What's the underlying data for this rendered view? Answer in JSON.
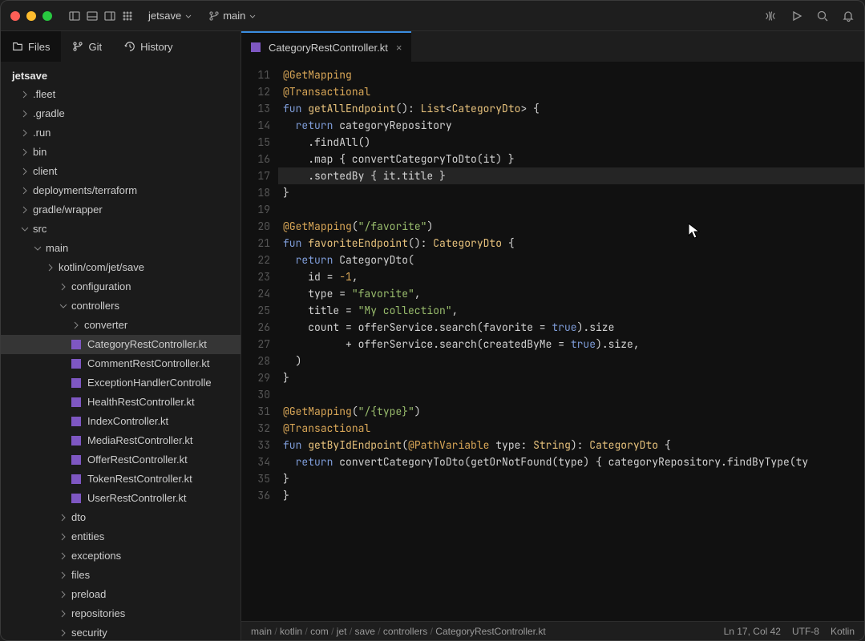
{
  "title_bar": {
    "project": "jetsave",
    "branch": "main"
  },
  "sidebar": {
    "tabs": [
      {
        "label": "Files",
        "active": true
      },
      {
        "label": "Git",
        "active": false
      },
      {
        "label": "History",
        "active": false
      }
    ],
    "root": "jetsave",
    "tree": [
      {
        "d": 1,
        "k": "f",
        "label": ".fleet"
      },
      {
        "d": 1,
        "k": "f",
        "label": ".gradle"
      },
      {
        "d": 1,
        "k": "f",
        "label": ".run"
      },
      {
        "d": 1,
        "k": "f",
        "label": "bin"
      },
      {
        "d": 1,
        "k": "f",
        "label": "client"
      },
      {
        "d": 1,
        "k": "f",
        "label": "deployments/terraform"
      },
      {
        "d": 1,
        "k": "f",
        "label": "gradle/wrapper"
      },
      {
        "d": 1,
        "k": "fo",
        "label": "src"
      },
      {
        "d": 2,
        "k": "fo",
        "label": "main"
      },
      {
        "d": 3,
        "k": "f",
        "label": "kotlin/com/jet/save"
      },
      {
        "d": 4,
        "k": "f",
        "label": "configuration"
      },
      {
        "d": 4,
        "k": "fo",
        "label": "controllers"
      },
      {
        "d": 5,
        "k": "f",
        "label": "converter"
      },
      {
        "d": 5,
        "k": "kt",
        "label": "CategoryRestController.kt",
        "sel": true
      },
      {
        "d": 5,
        "k": "kt",
        "label": "CommentRestController.kt"
      },
      {
        "d": 5,
        "k": "kt",
        "label": "ExceptionHandlerControlle"
      },
      {
        "d": 5,
        "k": "kt",
        "label": "HealthRestController.kt"
      },
      {
        "d": 5,
        "k": "kt",
        "label": "IndexController.kt"
      },
      {
        "d": 5,
        "k": "kt",
        "label": "MediaRestController.kt"
      },
      {
        "d": 5,
        "k": "kt",
        "label": "OfferRestController.kt"
      },
      {
        "d": 5,
        "k": "kt",
        "label": "TokenRestController.kt"
      },
      {
        "d": 5,
        "k": "kt",
        "label": "UserRestController.kt"
      },
      {
        "d": 4,
        "k": "f",
        "label": "dto"
      },
      {
        "d": 4,
        "k": "f",
        "label": "entities"
      },
      {
        "d": 4,
        "k": "f",
        "label": "exceptions"
      },
      {
        "d": 4,
        "k": "f",
        "label": "files"
      },
      {
        "d": 4,
        "k": "f",
        "label": "preload"
      },
      {
        "d": 4,
        "k": "f",
        "label": "repositories"
      },
      {
        "d": 4,
        "k": "f",
        "label": "security"
      }
    ]
  },
  "editor": {
    "tab_label": "CategoryRestController.kt",
    "first_line": 11,
    "highlight_line": 17,
    "lines": [
      [
        [
          "@",
          "ann"
        ],
        [
          "GetMapping",
          "ann"
        ]
      ],
      [
        [
          "@",
          "ann"
        ],
        [
          "Transactional",
          "ann"
        ]
      ],
      [
        [
          "fun ",
          "kw"
        ],
        [
          "getAllEndpoint",
          "fn"
        ],
        [
          "(): ",
          ""
        ],
        [
          "List",
          "type"
        ],
        [
          "<",
          ""
        ],
        [
          "CategoryDto",
          "type"
        ],
        [
          "> {",
          ""
        ]
      ],
      [
        [
          "  ",
          ""
        ],
        [
          "return ",
          "kw"
        ],
        [
          "categoryRepository",
          ""
        ]
      ],
      [
        [
          "    .findAll()",
          ""
        ]
      ],
      [
        [
          "    .map { convertCategoryToDto(it) }",
          ""
        ]
      ],
      [
        [
          "    .sortedBy { it.title }",
          ""
        ]
      ],
      [
        [
          "}",
          ""
        ]
      ],
      [
        [
          "",
          ""
        ]
      ],
      [
        [
          "@",
          "ann"
        ],
        [
          "GetMapping",
          "ann"
        ],
        [
          "(",
          ""
        ],
        [
          "\"/favorite\"",
          "str"
        ],
        [
          ")",
          ""
        ]
      ],
      [
        [
          "fun ",
          "kw"
        ],
        [
          "favoriteEndpoint",
          "fn"
        ],
        [
          "(): ",
          ""
        ],
        [
          "CategoryDto",
          "type"
        ],
        [
          " {",
          ""
        ]
      ],
      [
        [
          "  ",
          ""
        ],
        [
          "return ",
          "kw"
        ],
        [
          "CategoryDto(",
          ""
        ]
      ],
      [
        [
          "    id = ",
          ""
        ],
        [
          "-1",
          "lit"
        ],
        [
          ",",
          ""
        ]
      ],
      [
        [
          "    type = ",
          ""
        ],
        [
          "\"favorite\"",
          "str"
        ],
        [
          ",",
          ""
        ]
      ],
      [
        [
          "    title = ",
          ""
        ],
        [
          "\"My collection\"",
          "str"
        ],
        [
          ",",
          ""
        ]
      ],
      [
        [
          "    count = offerService.search(favorite = ",
          ""
        ],
        [
          "true",
          "kw"
        ],
        [
          ").size",
          ""
        ]
      ],
      [
        [
          "          + offerService.search(createdByMe = ",
          ""
        ],
        [
          "true",
          "kw"
        ],
        [
          ").size,",
          ""
        ]
      ],
      [
        [
          "  )",
          ""
        ]
      ],
      [
        [
          "}",
          ""
        ]
      ],
      [
        [
          "",
          ""
        ]
      ],
      [
        [
          "@",
          "ann"
        ],
        [
          "GetMapping",
          "ann"
        ],
        [
          "(",
          ""
        ],
        [
          "\"/{type}\"",
          "str"
        ],
        [
          ")",
          ""
        ]
      ],
      [
        [
          "@",
          "ann"
        ],
        [
          "Transactional",
          "ann"
        ]
      ],
      [
        [
          "fun ",
          "kw"
        ],
        [
          "getByIdEndpoint",
          "fn"
        ],
        [
          "(",
          ""
        ],
        [
          "@",
          "ann"
        ],
        [
          "PathVariable",
          "ann"
        ],
        [
          " type: ",
          ""
        ],
        [
          "String",
          "type"
        ],
        [
          "): ",
          ""
        ],
        [
          "CategoryDto",
          "type"
        ],
        [
          " {",
          ""
        ]
      ],
      [
        [
          "  ",
          ""
        ],
        [
          "return ",
          "kw"
        ],
        [
          "convertCategoryToDto(getOrNotFound(type) { categoryRepository.findByType(ty",
          ""
        ]
      ],
      [
        [
          "}",
          ""
        ]
      ],
      [
        [
          "}",
          ""
        ]
      ]
    ]
  },
  "breadcrumbs": [
    "main",
    "kotlin",
    "com",
    "jet",
    "save",
    "controllers",
    "CategoryRestController.kt"
  ],
  "status": {
    "position": "Ln 17, Col 42",
    "encoding": "UTF-8",
    "language": "Kotlin"
  }
}
